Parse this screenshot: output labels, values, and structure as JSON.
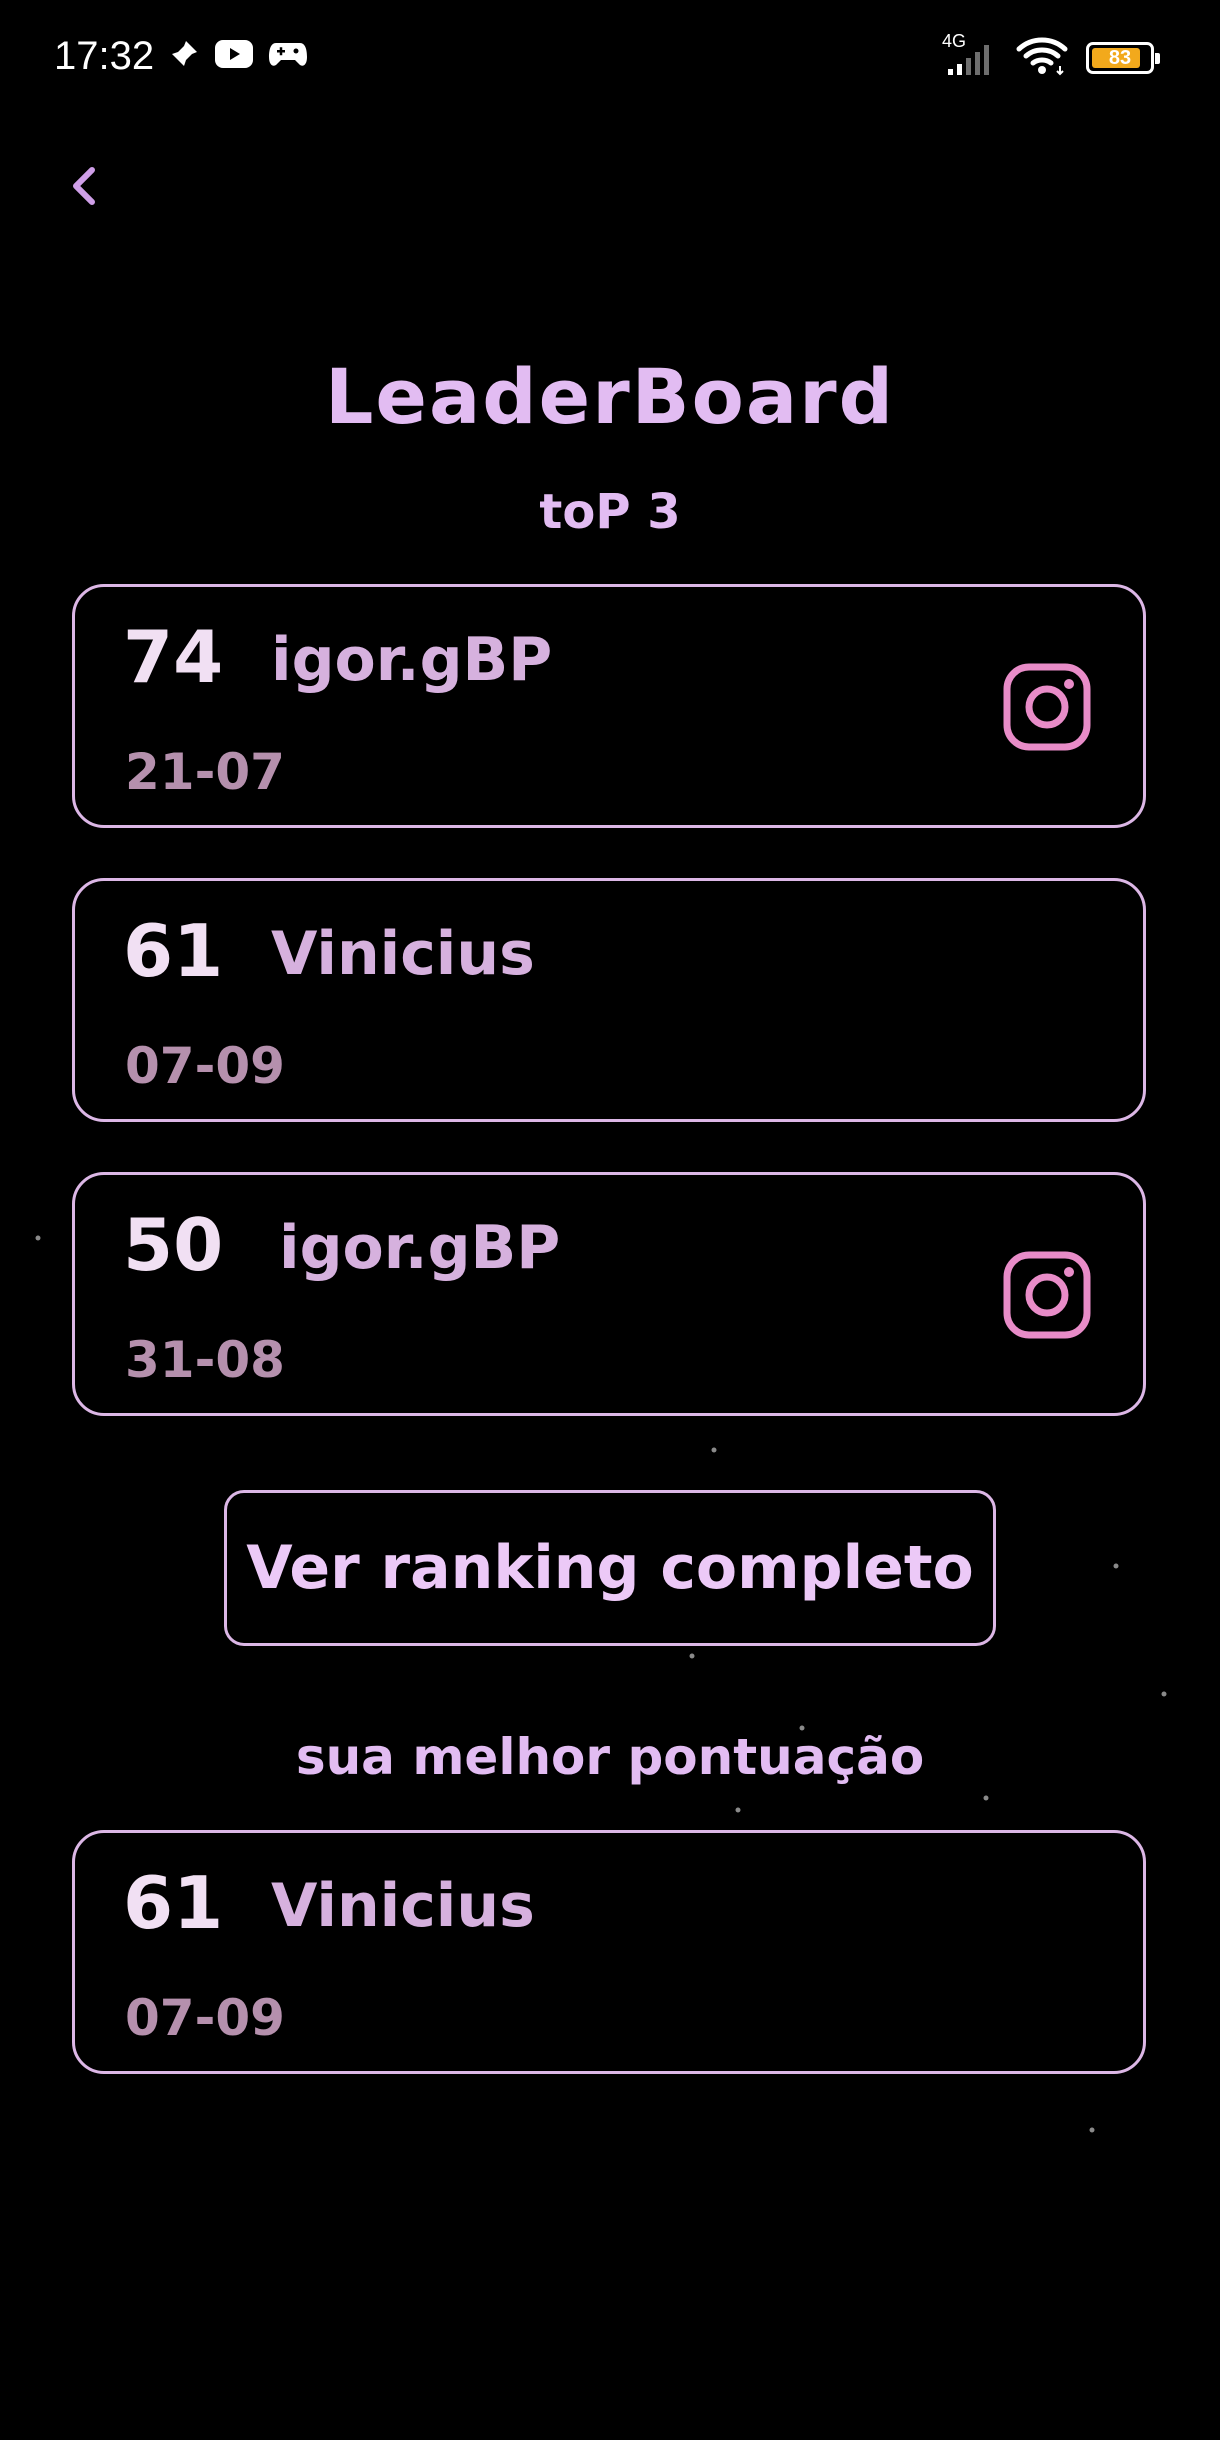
{
  "status_bar": {
    "time": "17:32",
    "network": "4G",
    "battery": "83",
    "battery_level": 0.83,
    "left_icons": [
      "pin-icon",
      "youtube-icon",
      "gamepad-icon"
    ],
    "right_icons": [
      "signal-icon",
      "wifi-icon",
      "battery-icon"
    ]
  },
  "header": {
    "back_icon": "chevron-left-icon",
    "title": "LeaderBoard",
    "top3_label": "toP 3"
  },
  "top3": [
    {
      "score": "74",
      "name": "igor.gBP",
      "date": "21-07",
      "instagram": true
    },
    {
      "score": "61",
      "name": "Vinicius",
      "date": "07-09",
      "instagram": false
    },
    {
      "score": "50",
      "name": "igor.gBP",
      "date": "31-08",
      "instagram": true
    }
  ],
  "ranking_button_label": "Ver ranking completo",
  "best": {
    "label": "sua melhor pontuação",
    "score": "61",
    "name": "Vinicius",
    "date": "07-09"
  },
  "colors": {
    "background": "#000000",
    "accent": "#e2bcf2",
    "border": "#dcb7e6",
    "instagram": "#e88cc8",
    "battery": "#f2a91c"
  }
}
